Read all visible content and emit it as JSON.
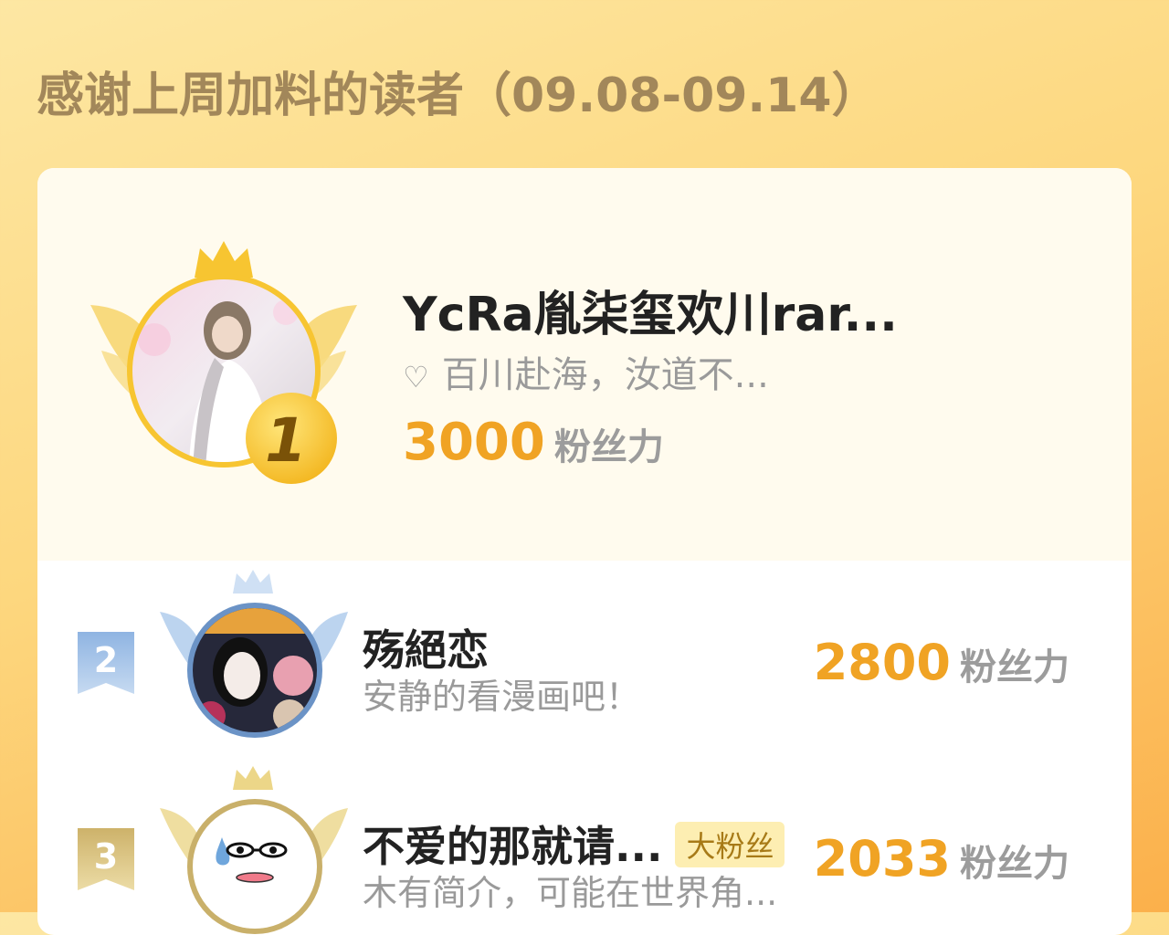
{
  "header": {
    "title": "感谢上周加料的读者（09.08-09.14）"
  },
  "unit_label": "粉丝力",
  "colors": {
    "score": "#f0a324",
    "gold": "#f7c531",
    "silver": "#aac9ea",
    "bronze": "#e6cf86"
  },
  "ranking": [
    {
      "rank": "1",
      "name": "YcRa胤柒玺欢川rar...",
      "signature": "百川赴海，汝道不...",
      "signature_icon": "heart-icon",
      "score": "3000",
      "unit": "粉丝力"
    },
    {
      "rank": "2",
      "name": "殇絕恋",
      "signature": "安静的看漫画吧！",
      "score": "2800",
      "unit": "粉丝力"
    },
    {
      "rank": "3",
      "name": "不爱的那就请...",
      "badge": "大粉丝",
      "signature": "木有简介，可能在世界角...",
      "score": "2033",
      "unit": "粉丝力"
    }
  ]
}
